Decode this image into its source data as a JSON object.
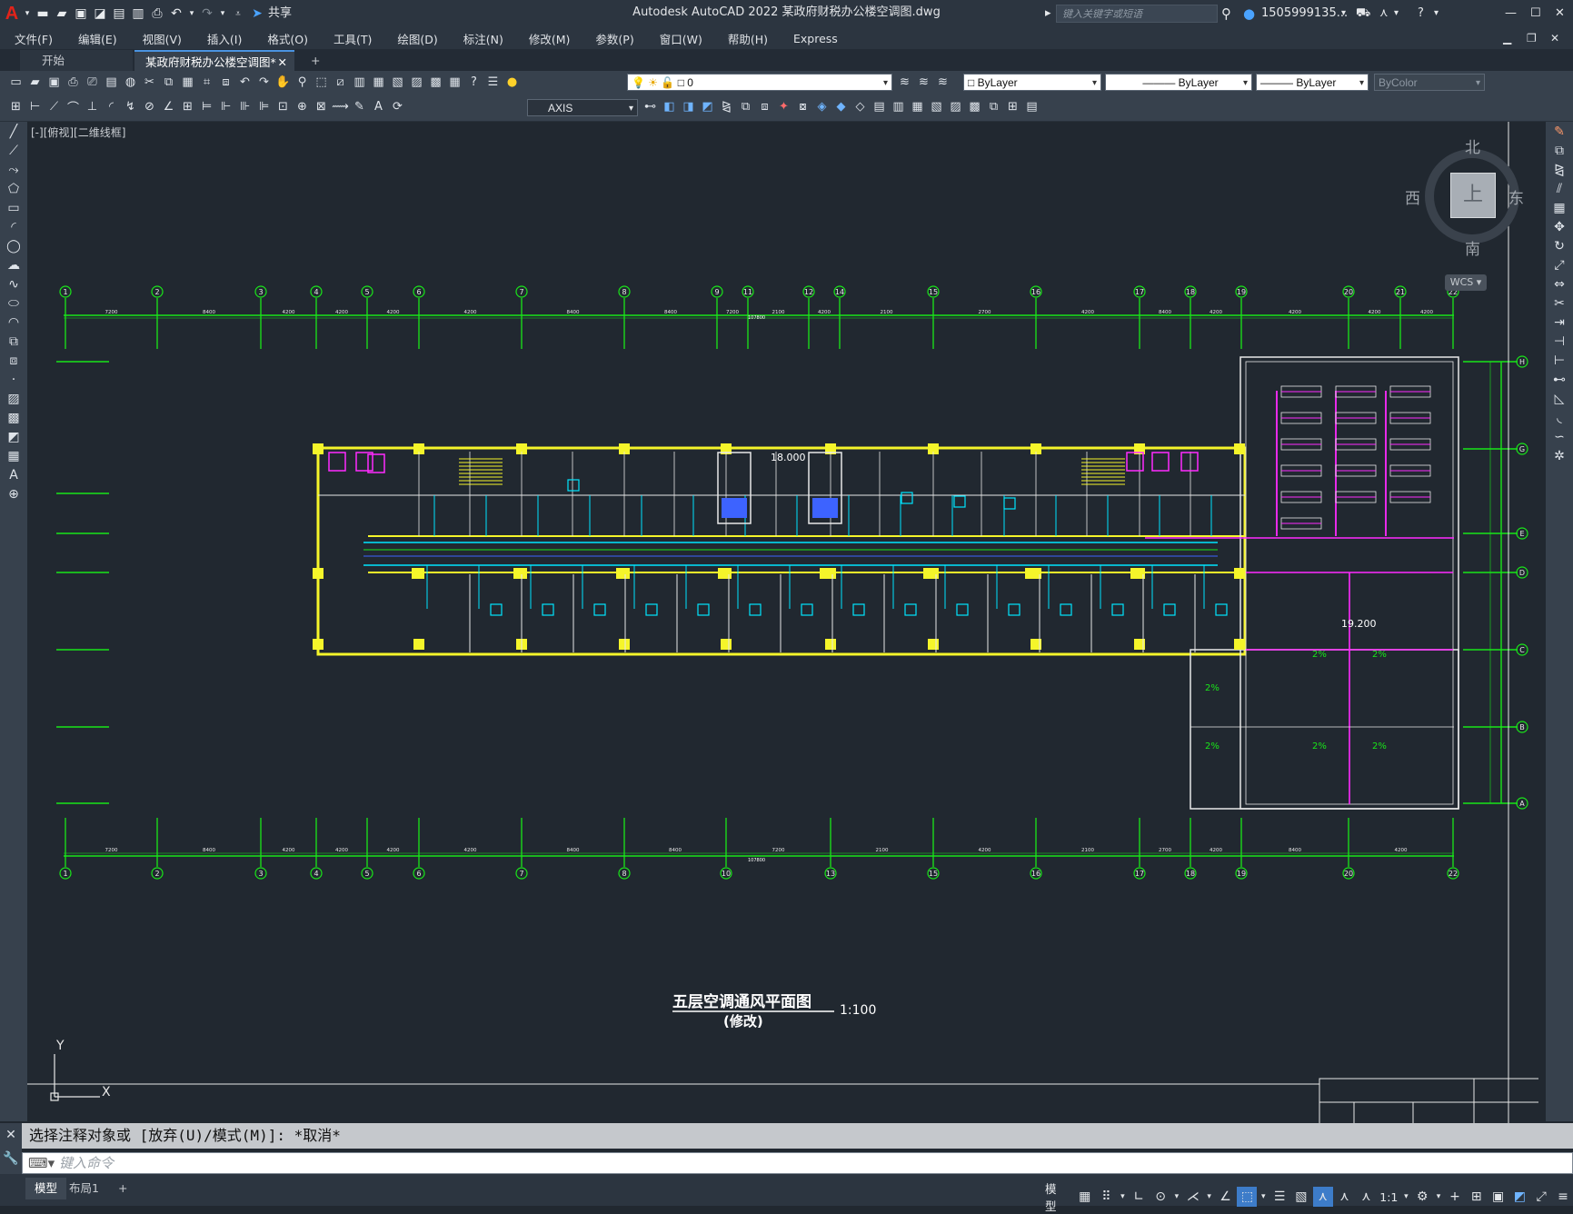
{
  "titlebar": {
    "app_title": "Autodesk AutoCAD 2022    某政府财税办公楼空调图.dwg",
    "share_label": "共享",
    "search_placeholder": "键入关键字或短语",
    "user": "1505999135...",
    "window_controls": [
      "minimize-icon",
      "maximize-icon",
      "close-icon"
    ]
  },
  "menubar": {
    "items": [
      "文件(F)",
      "编辑(E)",
      "视图(V)",
      "插入(I)",
      "格式(O)",
      "工具(T)",
      "绘图(D)",
      "标注(N)",
      "修改(M)",
      "参数(P)",
      "窗口(W)",
      "帮助(H)",
      "Express"
    ]
  },
  "tabs": {
    "start": "开始",
    "drawing": "某政府财税办公楼空调图*",
    "add": "+"
  },
  "toolbar": {
    "layer_value": "0",
    "color_value": "ByLayer",
    "linetype_value": "ByLayer",
    "lineweight_value": "ByLayer",
    "plotstyle_value": "ByColor",
    "dimstyle_value": "AXIS"
  },
  "viewport": {
    "label": "[-][俯视][二维线框]",
    "viewcube": {
      "north": "北",
      "south": "南",
      "east": "东",
      "west": "西",
      "face": "上",
      "wcs": "WCS"
    },
    "ucs": {
      "x": "X",
      "y": "Y"
    }
  },
  "drawing": {
    "title": "五层空调通风平面图",
    "subtitle": "(修改)",
    "scale": "1:100",
    "top_axes": [
      "1",
      "2",
      "3",
      "4",
      "5",
      "6",
      "7",
      "8",
      "9",
      "11",
      "12",
      "14",
      "15",
      "16",
      "17",
      "18",
      "19",
      "20",
      "21",
      "22"
    ],
    "bottom_axes": [
      "1",
      "2",
      "3",
      "4",
      "5",
      "6",
      "7",
      "8",
      "10",
      "13",
      "15",
      "16",
      "17",
      "18",
      "19",
      "20",
      "22"
    ],
    "right_axes": [
      "H",
      "G",
      "E",
      "D",
      "C",
      "B",
      "A"
    ],
    "top_dims": [
      "7200",
      "8400",
      "4200",
      "4200",
      "4200",
      "4200",
      "8400",
      "8400",
      "7200",
      "2100",
      "4200",
      "2100",
      "2700",
      "4200",
      "8400",
      "4200",
      "4200",
      "4200",
      "4200",
      "8400",
      "4200"
    ],
    "overall_dim": "107800",
    "elevation_1": "18.000",
    "elevation_2": "19.200",
    "slope_label": "2%",
    "colors": {
      "grid": "#19e619",
      "wall": "#f5f52a",
      "duct": "#00e5ff",
      "magenta": "#ff2bff",
      "white": "#e8e8e8",
      "blue": "#3d63ff"
    }
  },
  "command": {
    "history": "选择注释对象或 [放弃(U)/模式(M)]: *取消*",
    "placeholder": "键入命令"
  },
  "statusbar": {
    "tabs": [
      "模型",
      "布局1",
      "+"
    ],
    "model_label": "模型",
    "scale": "1:1"
  }
}
